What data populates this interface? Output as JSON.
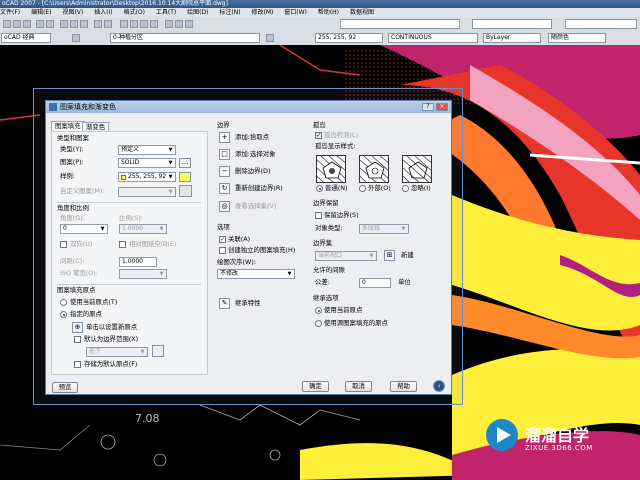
{
  "app": {
    "title": "oCAD 2007 - [C:\\Users\\Administrator\\Desktop\\2016.10.14大剧院总平面.dwg]",
    "menu": [
      "文件(F)",
      "编辑(E)",
      "视图(V)",
      "插入(I)",
      "格式(O)",
      "工具(T)",
      "绘图(D)",
      "标注(N)",
      "修改(M)",
      "窗口(W)",
      "帮助(H)",
      "数据视图"
    ],
    "workspace": "oCAD 经典",
    "layer": "0-种植分区",
    "color_combo": "255, 255, 92",
    "linetype_combo": "CONTINUOUS",
    "lineweight_combo": "ByLayer",
    "plotstyle_combo": "随颜色",
    "canvas_text": "7.08"
  },
  "dialog": {
    "title": "图案填充和渐变色",
    "tabs": [
      "图案填充",
      "渐变色"
    ],
    "type_and_pattern": {
      "heading": "类型和图案",
      "type_label": "类型(Y):",
      "type_value": "预定义",
      "pattern_label": "图案(P):",
      "pattern_value": "SOLID",
      "swatch_label": "样例:",
      "swatch_value": "255, 255, 92",
      "custom_label": "自定义图案(M):"
    },
    "angle_scale": {
      "heading": "角度和比例",
      "angle_label": "角度(G):",
      "angle_value": "0",
      "scale_label": "比例(S):",
      "scale_value": "1.0000",
      "double_label": "双向(U)",
      "relative_label": "相对图纸空间(E)",
      "spacing_label": "间距(C):",
      "spacing_value": "1.0000",
      "iso_label": "ISO 笔宽(O):"
    },
    "origin": {
      "heading": "图案填充原点",
      "use_current": "使用当前原点(T)",
      "specified": "指定的原点",
      "click_set": "单击以设置新原点",
      "default_extent": "默认为边界范围(X)",
      "position_value": "左下",
      "store_default": "存储为默认原点(F)"
    },
    "boundary": {
      "heading": "边界",
      "add_pick": "添加:拾取点",
      "add_select": "添加:选择对象",
      "remove": "删除边界(D)",
      "recreate": "重新创建边界(R)",
      "view_sel": "查看选择集(V)"
    },
    "options": {
      "heading": "选项",
      "associative": "关联(A)",
      "separate": "创建独立的图案填充(H)",
      "draw_order_label": "绘图次序(W):",
      "draw_order_value": "不修改"
    },
    "inherit": "继承特性",
    "islands": {
      "heading": "孤岛",
      "detect": "孤岛检测(L)",
      "display_label": "孤岛显示样式:",
      "normal": "普通(N)",
      "outer": "外部(O)",
      "ignore": "忽略(I)"
    },
    "boundary_retain": {
      "heading": "边界保留",
      "retain": "保留边界(S)",
      "object_type_label": "对象类型:",
      "object_type_value": "多段线"
    },
    "boundary_set": {
      "heading": "边界集",
      "value": "当前视口",
      "new": "新建"
    },
    "gap": {
      "heading": "允许的间隙",
      "tolerance_label": "公差:",
      "tolerance_value": "0",
      "unit": "单位"
    },
    "inherit_options": {
      "heading": "继承选项",
      "use_current": "使用当前原点",
      "use_source": "使用源图案填充的原点"
    },
    "buttons": {
      "preview": "预览",
      "ok": "确定",
      "cancel": "取消",
      "help": "帮助"
    }
  },
  "watermark": {
    "name": "溜溜自学",
    "url": "ZIXUE.3D66.COM"
  },
  "colors": {
    "hatch_yellow": "#FFFF5C",
    "canvas_bg": "#000000"
  }
}
